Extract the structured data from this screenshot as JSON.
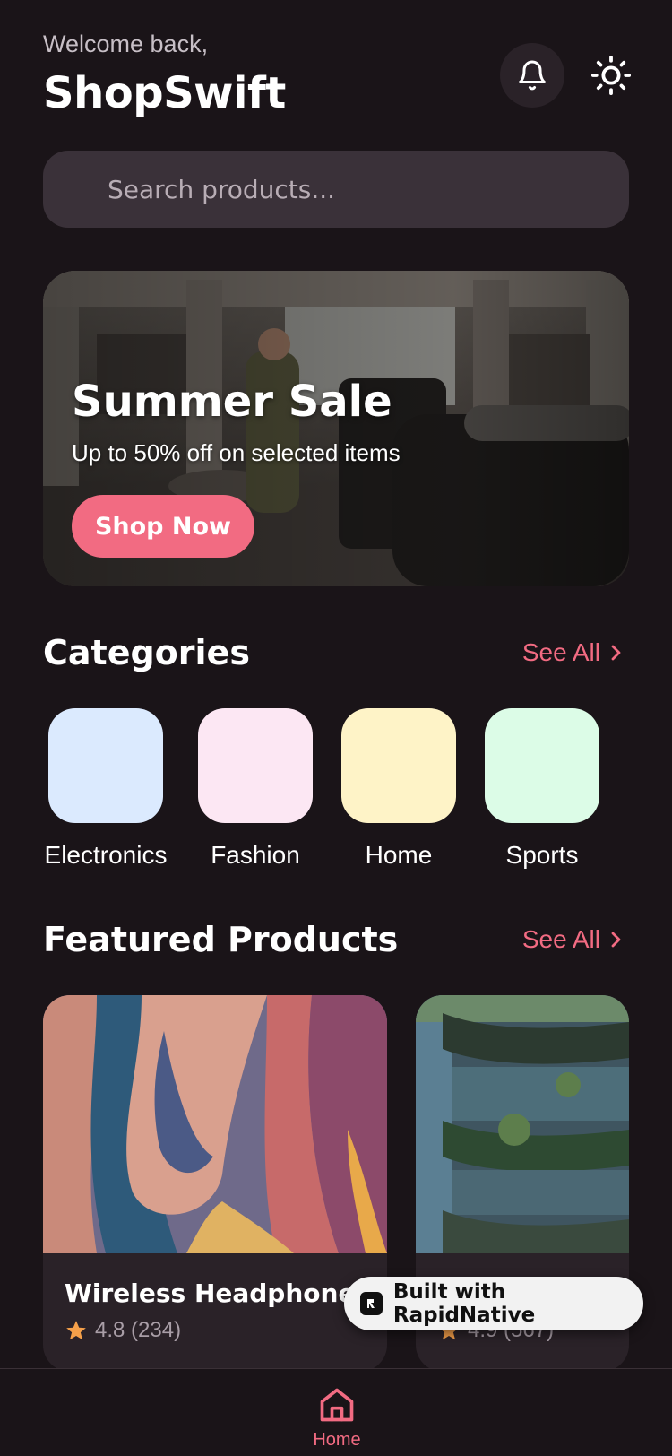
{
  "header": {
    "greeting": "Welcome back,",
    "app_title": "ShopSwift",
    "bell_icon": "bell-icon",
    "theme_icon": "sun-icon"
  },
  "search": {
    "placeholder": "Search products..."
  },
  "banner": {
    "title": "Summer Sale",
    "subtitle": "Up to 50% off on selected items",
    "cta_label": "Shop Now"
  },
  "categories_section": {
    "title": "Categories",
    "see_all": "See All",
    "items": [
      {
        "label": "Electronics",
        "color": "#dbeafe"
      },
      {
        "label": "Fashion",
        "color": "#fce7f3"
      },
      {
        "label": "Home",
        "color": "#fef3c7"
      },
      {
        "label": "Sports",
        "color": "#dcfce7"
      }
    ]
  },
  "featured_section": {
    "title": "Featured Products",
    "see_all": "See All",
    "products": [
      {
        "name": "Wireless Headphones",
        "rating": "4.8 (234)"
      },
      {
        "name": "",
        "rating": "4.9 (567)"
      }
    ]
  },
  "badge": {
    "label": "Built with RapidNative"
  },
  "bottom_nav": {
    "home_label": "Home"
  },
  "colors": {
    "accent": "#f26b82",
    "background": "#1a1418",
    "surface": "#2a2228"
  }
}
